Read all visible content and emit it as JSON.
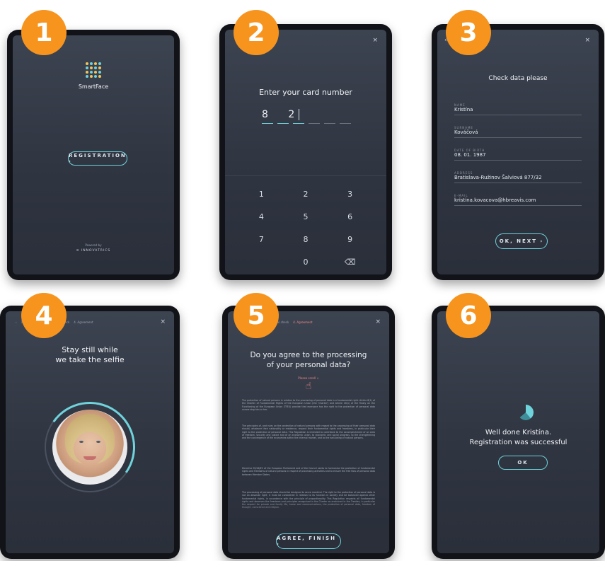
{
  "badges": [
    "1",
    "2",
    "3",
    "4",
    "5",
    "6"
  ],
  "screen1": {
    "brand": "SmartFace",
    "registration_label": "REGISTRATION  ›",
    "powered_by": "Powered by",
    "powered_company": "≡ INNOVATRICS"
  },
  "screen2": {
    "title": "Enter your card number",
    "entered_digits": "8 2",
    "close_glyph": "×",
    "keys": [
      "1",
      "2",
      "3",
      "4",
      "5",
      "6",
      "7",
      "8",
      "9",
      "",
      "0",
      "⌫"
    ]
  },
  "screen3": {
    "title": "Check data please",
    "back_glyph": "‹",
    "close_glyph": "×",
    "fields": [
      {
        "label": "NAME",
        "value": "Kristína"
      },
      {
        "label": "SURNAME",
        "value": "Kováčová"
      },
      {
        "label": "DATE OF BIRTH",
        "value": "08. 01. 1987"
      },
      {
        "label": "ADDRESS",
        "value": "Bratislava-Ružinov Šalviová 877/32"
      },
      {
        "label": "E-MAIL",
        "value": "kristina.kovacova@hbreavis.com"
      }
    ],
    "next_label": "OK, NEXT  ›"
  },
  "screen4": {
    "steps": [
      "‹",
      "1 Card",
      "2. Selfie",
      "3. Final check",
      "4. Agreement"
    ],
    "title_line1": "Stay still while",
    "title_line2": "we take the selfie",
    "close_glyph": "×"
  },
  "screen5": {
    "steps": [
      "‹",
      "1 Card",
      "2. Selfie",
      "3. Final check",
      "4. Agreement"
    ],
    "title_line1": "Do you agree to the processing",
    "title_line2": "of your personal data?",
    "scroll_hint": "Please scroll ↓",
    "paragraphs": [
      "The protection of natural persons in relation to the processing of personal data is a fundamental right. Article 8(1) of the Charter of Fundamental Rights of the European Union (the 'Charter') and Article 16(1) of the Treaty on the Functioning of the European Union (TFEU) provide that everyone has the right to the protection of personal data concerning him or her.",
      "The principles of, and rules on the protection of natural persons with regard to the processing of their personal data should, whatever their nationality or residence, respect their fundamental rights and freedoms, in particular their right to the protection of personal data. This Regulation is intended to contribute to the accomplishment of an area of freedom, security and justice and of an economic union, to economic and social progress, to the strengthening and the convergence of the economies within the internal market, and to the well-being of natural persons.",
      "Directive 95/46/EC of the European Parliament and of the Council seeks to harmonise the protection of fundamental rights and freedoms of natural persons in respect of processing activities and to ensure the free flow of personal data between Member States.",
      "The processing of personal data should be designed to serve mankind. The right to the protection of personal data is not an absolute right; it must be considered in relation to its function in society and be balanced against other fundamental rights, in accordance with the principle of proportionality. This Regulation respects all fundamental rights and observes the freedoms and principles recognised in the Charter as enshrined in the Treaties, in particular the respect for private and family life, home and communications, the protection of personal data, freedom of thought, conscience and religion."
    ],
    "finish_label": "AGREE, FINISH  ›",
    "close_glyph": "×"
  },
  "screen6": {
    "line1": "Well done Kristína.",
    "line2": "Registration was successful",
    "ok_label": "OK"
  },
  "colors": {
    "badge": "#f7941e",
    "accent": "#6fd3dc",
    "screen_bg": "#343a46",
    "highlight": "#f08a8a"
  }
}
